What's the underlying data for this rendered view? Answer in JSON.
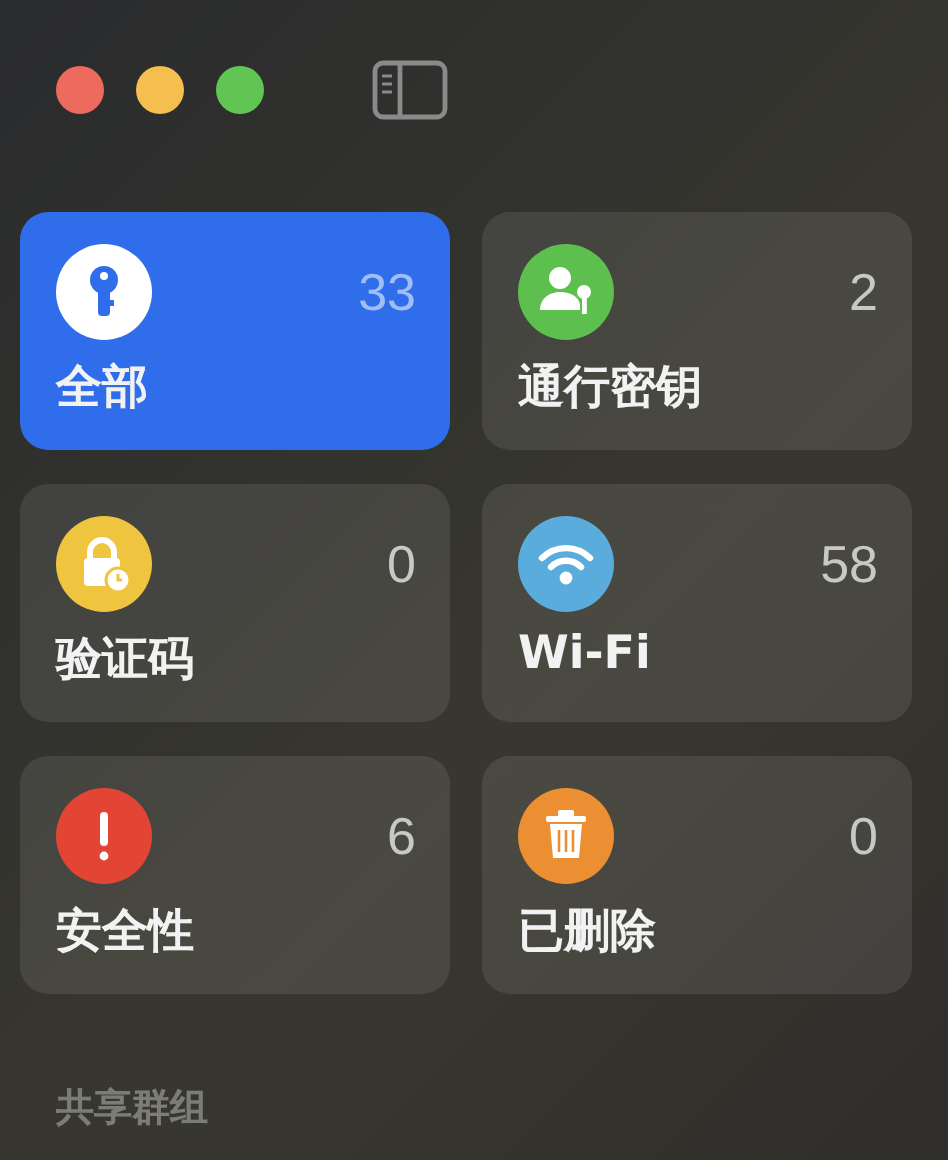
{
  "window": {
    "controls": [
      {
        "color": "#ec6a5e"
      },
      {
        "color": "#f4bf4f"
      },
      {
        "color": "#61c554"
      }
    ]
  },
  "categories": [
    {
      "kind": "key",
      "label": "全部",
      "count": "33",
      "color": "#ffffff",
      "selected": true
    },
    {
      "kind": "passkey",
      "label": "通行密钥",
      "count": "2",
      "color": "#5cbf4e",
      "selected": false
    },
    {
      "kind": "code",
      "label": "验证码",
      "count": "0",
      "color": "#efc53f",
      "selected": false
    },
    {
      "kind": "wifi",
      "label": "Wi-Fi",
      "count": "58",
      "color": "#5aacdc",
      "selected": false
    },
    {
      "kind": "alert",
      "label": "安全性",
      "count": "6",
      "color": "#e34535",
      "selected": false
    },
    {
      "kind": "trash",
      "label": "已删除",
      "count": "0",
      "color": "#ec8f32",
      "selected": false
    }
  ],
  "section_header": "共享群组"
}
